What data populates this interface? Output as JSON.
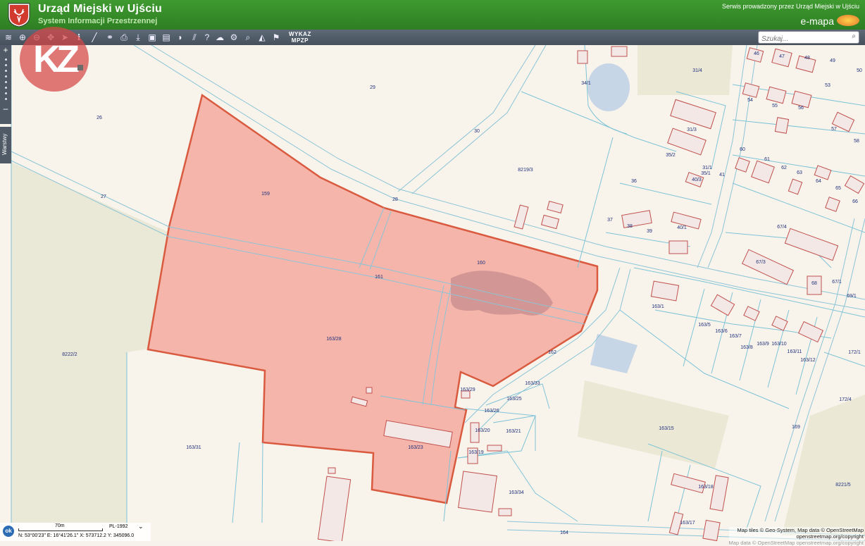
{
  "header": {
    "city_title": "Urząd Miejski w Ujściu",
    "system_subtitle": "System Informacji Przestrzennej",
    "provider_text": "Serwis prowadzony przez Urząd Miejski w Ujściu",
    "brand": "e-mapa"
  },
  "toolbar": {
    "tools": [
      "layers-icon",
      "zoom-in-icon",
      "zoom-out-icon",
      "pan-icon",
      "select-icon",
      "info-icon",
      "measure-icon",
      "link-icon",
      "print-icon",
      "download-icon",
      "overlay-icon",
      "layout-icon",
      "comment-icon",
      "hatch-icon",
      "help-icon",
      "upload-cloud-icon",
      "settings-icon",
      "search-map-icon",
      "draw-icon",
      "identify-icon"
    ],
    "wykaz_line1": "WYKAZ",
    "wykaz_line2": "MPZP",
    "search_placeholder": "Szukaj..."
  },
  "side": {
    "zoom_in": "+",
    "zoom_out": "–",
    "layers_tab": "Warstwy"
  },
  "watermark": {
    "text": "KZ"
  },
  "scale": {
    "ok": "ok",
    "scale_label": "70m",
    "crs": "PL-1992",
    "coordinates": "N: 53°00'23\"    E: 16°41'26.1\"    X: 573712.2    Y: 345096.0"
  },
  "attribution": {
    "line1": "Map tiles © Geo-System, Map data © OpenStreetMap",
    "line2": "openstreetmap.org/copyright",
    "line3": "Map data © OpenStreetMap openstreetmap.org/copyright"
  },
  "colors": {
    "highlight_fill": "#f4a9a0",
    "highlight_stroke": "#d95a3e",
    "parcel_line": "#7ec3d6",
    "building_line": "#c0504d"
  },
  "parcel_labels": [
    "29",
    "26",
    "27",
    "28",
    "159",
    "160",
    "161",
    "163/28",
    "8222/2",
    "163/31",
    "163/23",
    "163/29",
    "163/33",
    "163/25",
    "163/26",
    "163/20",
    "163/21",
    "163/19",
    "163/34",
    "162",
    "164",
    "8219/3",
    "30",
    "34/1",
    "31/4",
    "31/3",
    "35/2",
    "31/1",
    "35/1",
    "41",
    "40/3",
    "36",
    "37",
    "38",
    "39",
    "40/1",
    "163/1",
    "163/5",
    "163/6",
    "163/7",
    "163/8",
    "163/9",
    "163/10",
    "163/11",
    "163/12",
    "163/15",
    "163/18",
    "163/17",
    "169",
    "172/4",
    "172/1",
    "8221/5",
    "69/1",
    "67/4",
    "67/3",
    "67/1",
    "68",
    "46",
    "47",
    "48",
    "49",
    "50",
    "53",
    "54",
    "55",
    "56",
    "57",
    "58",
    "60",
    "61",
    "62",
    "63",
    "64",
    "65",
    "66"
  ]
}
